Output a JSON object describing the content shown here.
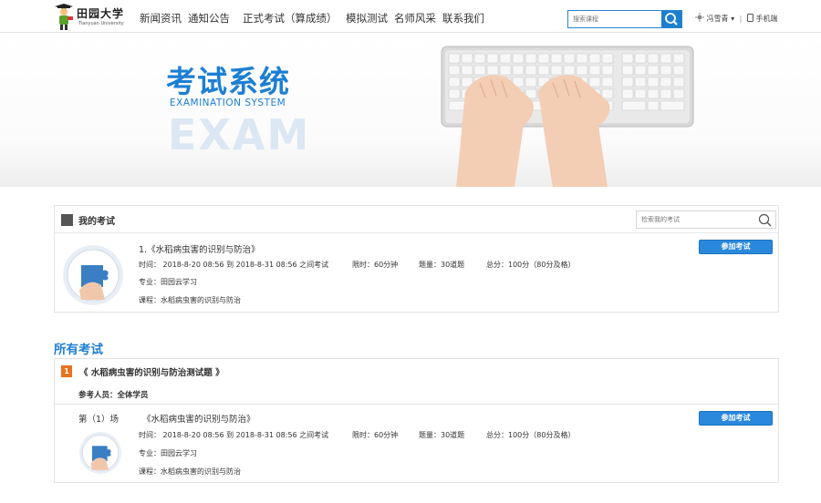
{
  "header": {
    "logo_text": "田园大学",
    "logo_sub": "Tianyuan University",
    "nav": [
      "新闻资讯",
      "通知公告",
      "正式考试（算成绩）",
      "模拟测试",
      "名师风采",
      "联系我们"
    ],
    "search_placeholder": "搜索课程",
    "user_name": "冯雪青",
    "user_caret": "▾",
    "separator": "|",
    "mobile_label": "手机端"
  },
  "banner": {
    "title": "考试系统",
    "subtitle": "EXAMINATION SYSTEM",
    "big_text": "EXAM"
  },
  "my_exam": {
    "title": "我的考试",
    "search_placeholder": "检索我的考试",
    "exam": {
      "name": "1.《水稻病虫害的识别与防治》",
      "time": "时间： 2018-8-20 08:56 到 2018-8-31 08:56 之间考试",
      "limit": "限时：60分钟",
      "count": "题量：30道题",
      "score": "总分：100分（80分及格）",
      "major": "专业：田园云学习",
      "course": "课程：水稻病虫害的识别与防治",
      "join_label": "参加考试"
    }
  },
  "all_exams": {
    "section_title": "所有考试",
    "group": {
      "number": "1",
      "title": "《 水稻病虫害的识别与防治测试题 》",
      "participants": "参考人员：全体学员",
      "round": "第（1）场",
      "name": "《水稻病虫害的识别与防治》",
      "time": "时间： 2018-8-20 08:56 到 2018-8-31 08:56 之间考试",
      "limit": "限时：60分钟",
      "count": "题量：30道题",
      "score": "总分：100分（80分及格）",
      "major": "专业：田园云学习",
      "course": "课程：水稻病虫害的识别与防治",
      "join_label": "参加考试"
    }
  },
  "colors": {
    "accent": "#1e7fd0",
    "button": "#2a88dc",
    "badge": "#e8731e"
  },
  "icons": [
    "graduate-logo-icon",
    "search-icon",
    "user-icon",
    "mobile-icon",
    "square-icon",
    "puzzle-hand-icon"
  ]
}
